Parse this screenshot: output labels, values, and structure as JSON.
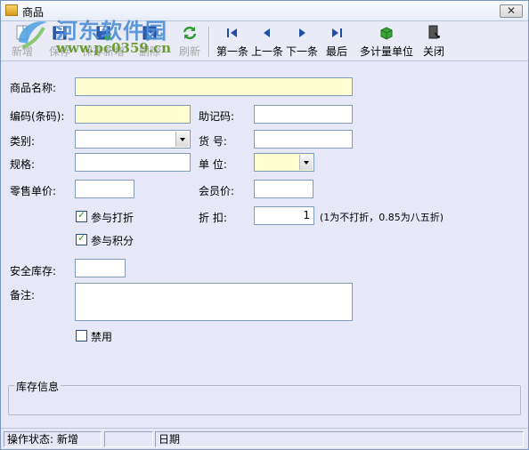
{
  "window": {
    "title": "商品",
    "close_glyph": "✕"
  },
  "toolbar": {
    "items": [
      {
        "label": "新增",
        "icon": "new-doc-icon",
        "enabled": false
      },
      {
        "label": "保存",
        "icon": "save-icon",
        "enabled": false
      },
      {
        "label": "保存新增",
        "icon": "save-new-icon",
        "enabled": false
      },
      {
        "label": "删除",
        "icon": "delete-icon",
        "enabled": false
      },
      {
        "label": "刷新",
        "icon": "refresh-icon",
        "enabled": false
      },
      {
        "label": "第一条",
        "icon": "first-record-icon",
        "enabled": true
      },
      {
        "label": "上一条",
        "icon": "prev-record-icon",
        "enabled": true
      },
      {
        "label": "下一条",
        "icon": "next-record-icon",
        "enabled": true
      },
      {
        "label": "最后",
        "icon": "last-record-icon",
        "enabled": true
      },
      {
        "label": "多计量单位",
        "icon": "multi-unit-icon",
        "enabled": true
      },
      {
        "label": "关闭",
        "icon": "close-door-icon",
        "enabled": true
      }
    ]
  },
  "watermark": {
    "site_name": "河东软件园",
    "url": "www.pc0359.cn"
  },
  "form": {
    "name_label": "商品名称:",
    "name_value": "",
    "code_label": "编码(条码):",
    "code_value": "",
    "mnemonic_label": "助记码:",
    "mnemonic_value": "",
    "category_label": "类别:",
    "category_value": "",
    "item_no_label": "货 号:",
    "item_no_value": "",
    "spec_label": "规格:",
    "spec_value": "",
    "unit_label": "单 位:",
    "unit_value": "",
    "retail_price_label": "零售单价:",
    "retail_price_value": "",
    "member_price_label": "会员价:",
    "member_price_value": "",
    "discount_check_label": "参与打折",
    "discount_checked": true,
    "discount_label": "折 扣:",
    "discount_value": "1",
    "discount_hint": "(1为不打折，0.85为八五折)",
    "points_check_label": "参与积分",
    "points_checked": true,
    "safety_stock_label": "安全库存:",
    "safety_stock_value": "",
    "remark_label": "备注:",
    "remark_value": "",
    "disable_check_label": "禁用",
    "disable_checked": false
  },
  "inventory": {
    "title": "库存信息"
  },
  "status": {
    "state_label": "操作状态:",
    "state_value": "新增",
    "middle": "",
    "date_label": "日期"
  },
  "colors": {
    "form_bg": "#e6e8f8",
    "required_field_bg": "#fefed0",
    "field_border": "#7f9db9"
  }
}
